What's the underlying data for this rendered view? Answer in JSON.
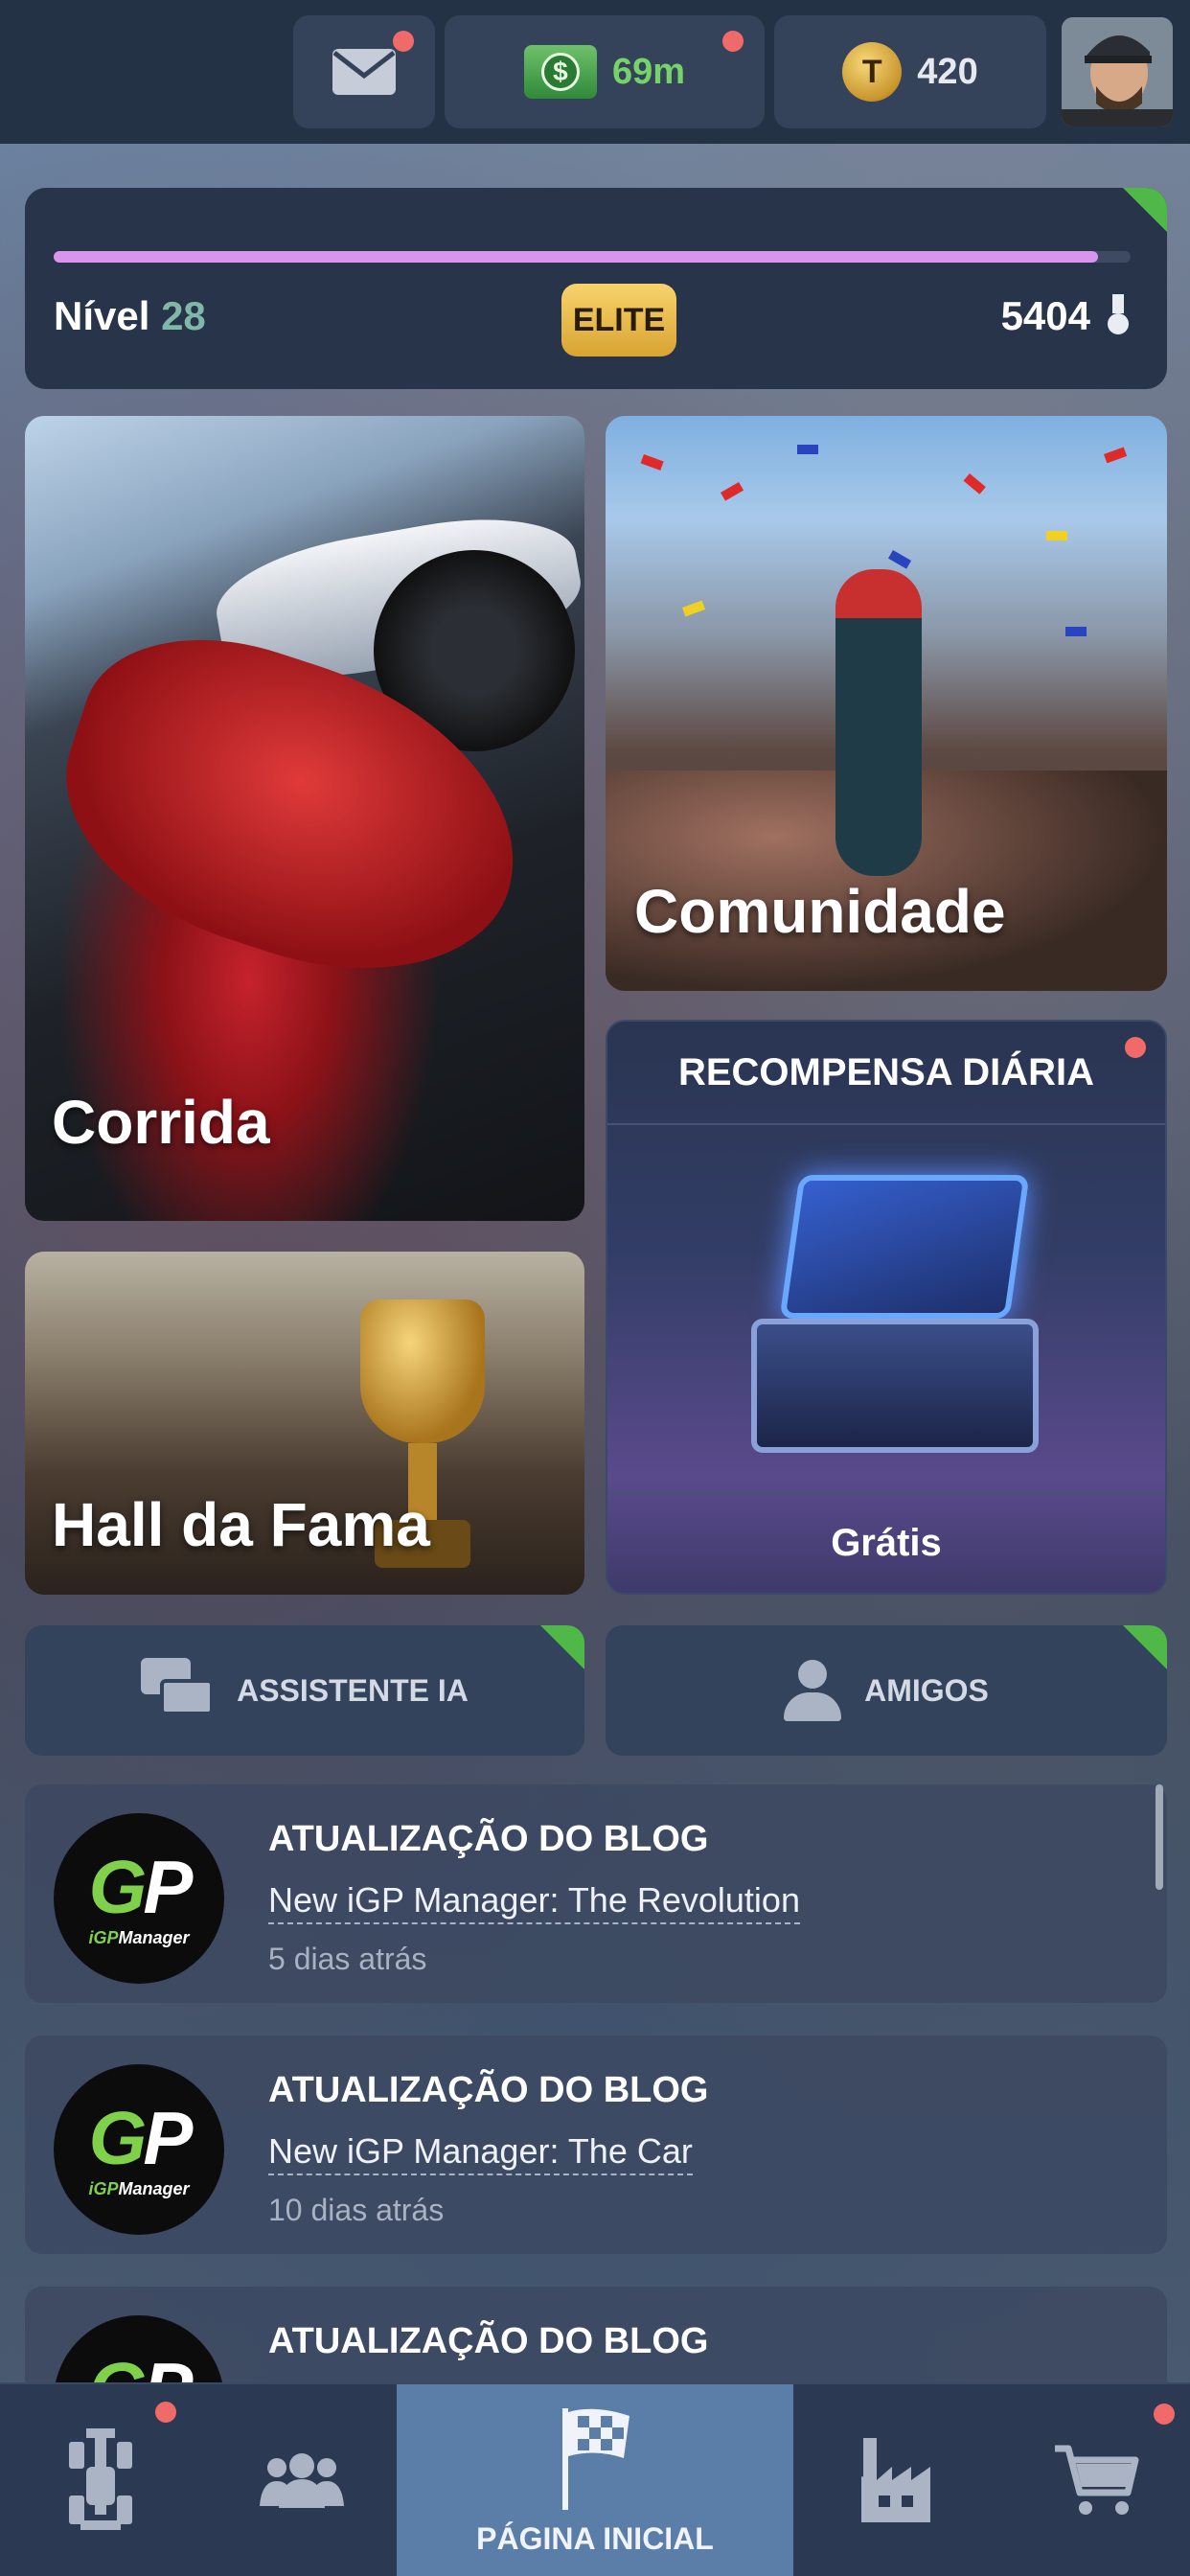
{
  "topbar": {
    "cash_amount": "69m",
    "cash_symbol": "$",
    "tokens": "420",
    "token_symbol": "T"
  },
  "level": {
    "label": "Nível",
    "number": "28",
    "badge": "ELITE",
    "points": "5404",
    "progress": 0.97
  },
  "tiles": {
    "race": "Corrida",
    "community": "Comunidade",
    "daily_reward_title": "RECOMPENSA DIÁRIA",
    "daily_reward_footer": "Grátis",
    "hall_of_fame": "Hall da Fama"
  },
  "buttons": {
    "assistant": "ASSISTENTE IA",
    "friends": "AMIGOS"
  },
  "blog": [
    {
      "kind": "ATUALIZAÇÃO DO BLOG",
      "title": "New iGP Manager: The Revolution",
      "date": "5 dias atrás"
    },
    {
      "kind": "ATUALIZAÇÃO DO BLOG",
      "title": "New iGP Manager: The Car",
      "date": "10 dias atrás"
    },
    {
      "kind": "ATUALIZAÇÃO DO BLOG",
      "title": "",
      "date": ""
    }
  ],
  "logo": {
    "gp": "GP",
    "brand": "iGPManager"
  },
  "bottom_nav": {
    "active_label": "PÁGINA INICIAL"
  },
  "colors": {
    "accent_green": "#4fb848",
    "progress": "#d795ee",
    "elite_gold": "#f8d36c",
    "notification": "#f06a6a",
    "cash_text": "#76d36a",
    "active_nav": "#5a7ea8"
  }
}
